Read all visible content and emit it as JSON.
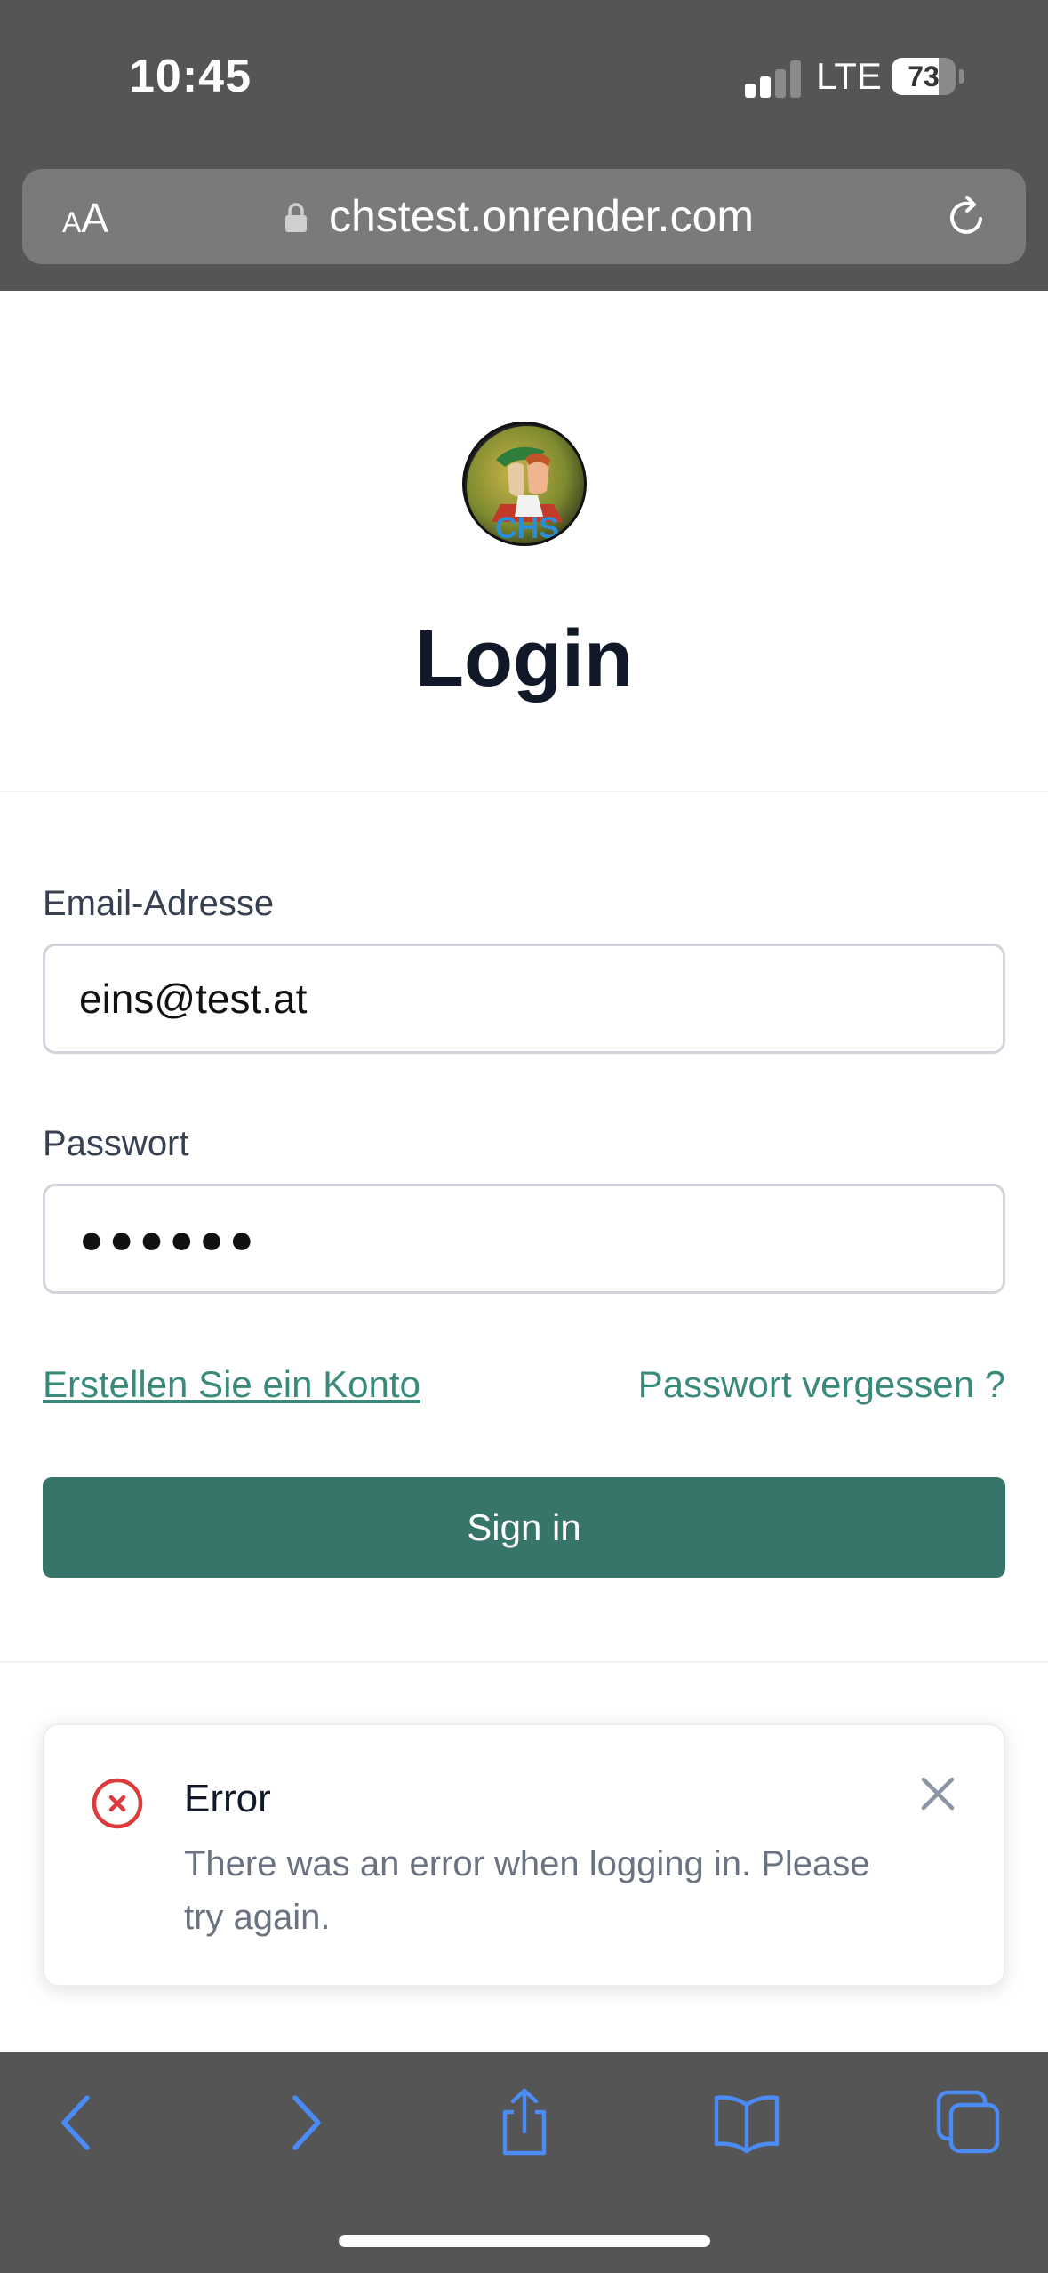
{
  "status_bar": {
    "time": "10:45",
    "network": "LTE",
    "battery": "73",
    "battery_level": 0.73,
    "signal_bars": 2
  },
  "browser": {
    "text_size_label_small": "A",
    "text_size_label_big": "A",
    "url": "chstest.onrender.com",
    "icons": [
      "lock-icon",
      "reload-icon"
    ]
  },
  "page": {
    "title": "Login",
    "email_label": "Email-Adresse",
    "email_value": "eins@test.at",
    "password_label": "Passwort",
    "password_value": "●●●●●●",
    "create_account_link": "Erstellen Sie ein Konto",
    "forgot_password_link": "Passwort vergessen ?",
    "sign_in_button": "Sign in"
  },
  "error_toast": {
    "title": "Error",
    "message": "There was an error when logging in. Please try again.",
    "icons": [
      "error-x-circle-icon",
      "close-icon"
    ]
  },
  "toolbar": {
    "icons": [
      "back-chevron-icon",
      "forward-chevron-icon",
      "share-icon",
      "bookmarks-icon",
      "tabs-icon"
    ]
  },
  "colors": {
    "chrome_gray": "#555555",
    "accent_teal": "#37756b",
    "link_teal": "#3a8a7c",
    "error_red": "#dc3b3b",
    "toolbar_blue": "#4b8bf5"
  }
}
